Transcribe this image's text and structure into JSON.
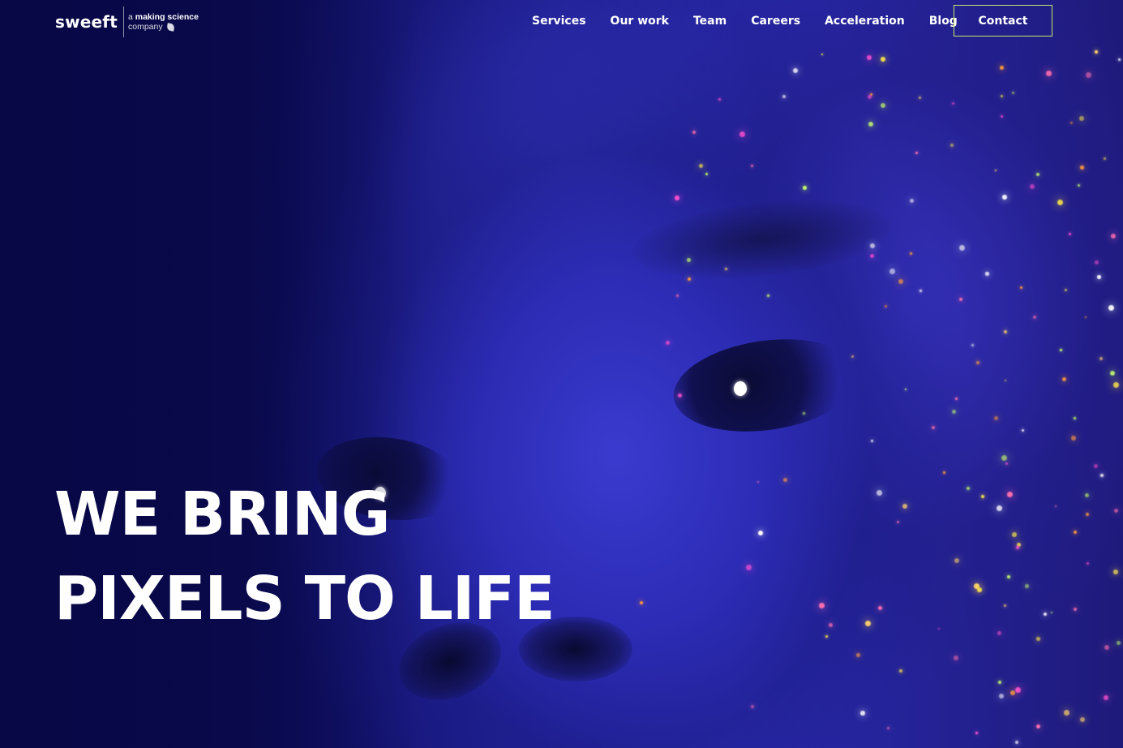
{
  "header": {
    "logo": {
      "wordmark": "sweeft",
      "tagline_prefix": "a",
      "tagline_brand": "making science",
      "tagline_suffix": "company"
    },
    "nav": [
      {
        "label": "Services"
      },
      {
        "label": "Our work"
      },
      {
        "label": "Team"
      },
      {
        "label": "Careers"
      },
      {
        "label": "Acceleration"
      },
      {
        "label": "Blog"
      }
    ],
    "contact_label": "Contact"
  },
  "hero": {
    "headline_line1": "WE BRING",
    "headline_line2": "PIXELS TO LIFE",
    "image_description_icon": "face-portrait-with-sparkles"
  },
  "colors": {
    "background": "#0b0b52",
    "accent_border": "#c7e96b",
    "text": "#ffffff"
  }
}
